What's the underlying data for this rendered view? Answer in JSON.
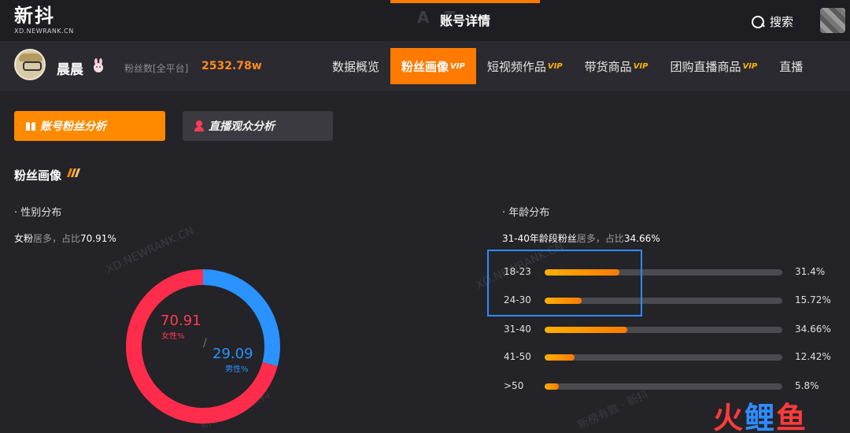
{
  "app": {
    "logo_text": "新抖",
    "logo_sub": "XD.NEWRANK.CN",
    "page_title": "账号详情",
    "header_watermark": "A     T",
    "search_label": "搜索"
  },
  "account": {
    "name": "晨晨",
    "fans_label": "粉丝数[全平台]",
    "fans_value": "2532.78w"
  },
  "nav": {
    "vip_tag": "VIP",
    "items": [
      {
        "label": "数据概览",
        "vip": false
      },
      {
        "label": "粉丝画像",
        "vip": true,
        "active": true
      },
      {
        "label": "短视频作品",
        "vip": true
      },
      {
        "label": "带货商品",
        "vip": true
      },
      {
        "label": "团购直播商品",
        "vip": true
      },
      {
        "label": "直播",
        "vip": false
      }
    ]
  },
  "subtabs": {
    "account_fans": "账号粉丝分析",
    "live_audience": "直播观众分析"
  },
  "section": {
    "title": "粉丝画像"
  },
  "gender": {
    "heading": "· 性别分布",
    "desc_prefix": "女粉",
    "desc_mid": "居多，占比",
    "desc_value": "70.91%",
    "female_value": "70.91",
    "female_label": "女性%",
    "male_value": "29.09",
    "male_label": "男性%",
    "female_color": "#ff2d4b",
    "male_color": "#2a93ff",
    "separator": "/"
  },
  "age": {
    "heading": "· 年龄分布",
    "desc_prefix": "31-40年龄段粉丝",
    "desc_mid": "居多，占比",
    "desc_value": "34.66%",
    "rows": [
      {
        "label": "18-23",
        "value": 31.4,
        "text": "31.4%"
      },
      {
        "label": "24-30",
        "value": 15.72,
        "text": "15.72%"
      },
      {
        "label": "31-40",
        "value": 34.66,
        "text": "34.66%"
      },
      {
        "label": "41-50",
        "value": 12.42,
        "text": "12.42%"
      },
      {
        "label": ">50",
        "value": 5.8,
        "text": "5.8%"
      }
    ]
  },
  "chart_data": [
    {
      "type": "pie",
      "categories": [
        "女性%",
        "男性%"
      ],
      "values": [
        70.91,
        29.09
      ]
    },
    {
      "type": "bar",
      "categories": [
        "18-23",
        "24-30",
        "31-40",
        "41-50",
        ">50"
      ],
      "values": [
        31.4,
        15.72,
        34.66,
        12.42,
        5.8
      ],
      "ylim": [
        0,
        100
      ]
    }
  ],
  "watermarks": {
    "site": "XD.NEWRANK.CN",
    "slogan": "新榜有数 · 新抖"
  },
  "brand": {
    "c1": "火",
    "c2": "鲤",
    "c3": "鱼"
  }
}
